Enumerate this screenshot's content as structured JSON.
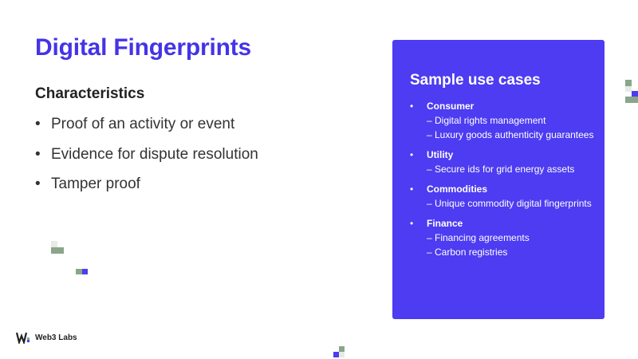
{
  "title": "Digital Fingerprints",
  "characteristics": {
    "heading": "Characteristics",
    "items": [
      "Proof of an activity or event",
      "Evidence for dispute resolution",
      "Tamper proof"
    ]
  },
  "use_cases": {
    "heading": "Sample use cases",
    "items": [
      {
        "name": "Consumer",
        "details": [
          "– Digital rights management",
          "– Luxury goods authenticity guarantees"
        ]
      },
      {
        "name": "Utility",
        "details": [
          "– Secure ids for grid energy assets"
        ]
      },
      {
        "name": "Commodities",
        "details": [
          "– Unique commodity digital fingerprints"
        ]
      },
      {
        "name": "Finance",
        "details": [
          "– Financing agreements",
          "– Carbon registries"
        ]
      }
    ]
  },
  "brand": {
    "name": "Web3 Labs",
    "logo_icon": "web3-labs-logo-icon"
  },
  "colors": {
    "accent": "#4533e8",
    "panel": "#4d3cf1",
    "decor_green": "#8aa68a",
    "decor_blue": "#4d3cf1",
    "decor_light": "#e6ebe6"
  }
}
